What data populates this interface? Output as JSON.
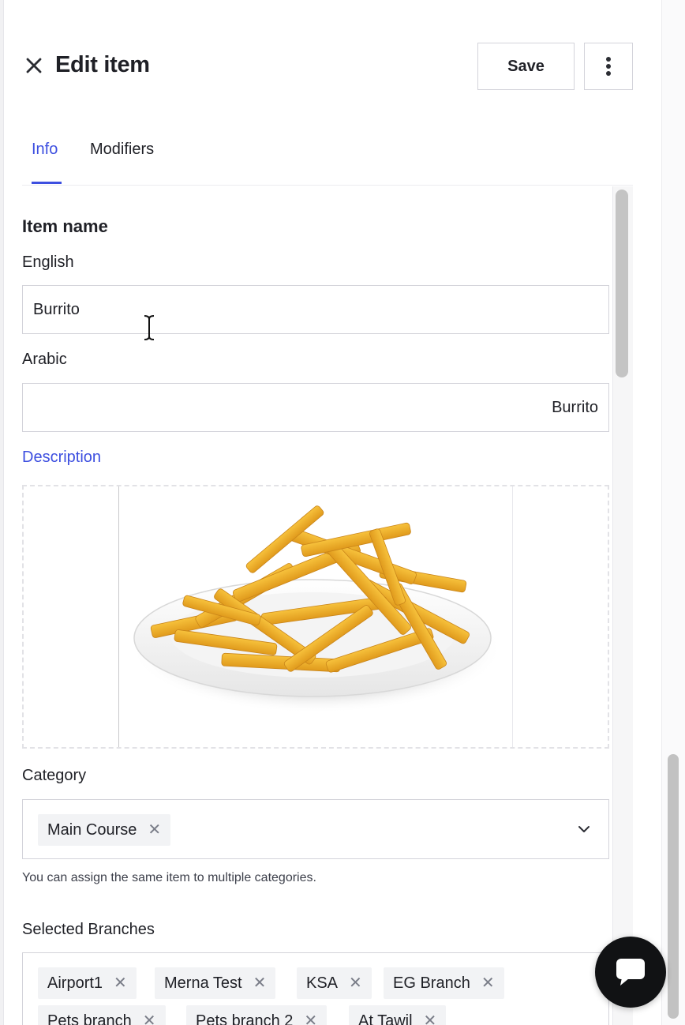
{
  "header": {
    "title": "Edit item",
    "save_label": "Save"
  },
  "tabs": [
    {
      "label": "Info",
      "active": true
    },
    {
      "label": "Modifiers",
      "active": false
    }
  ],
  "form": {
    "item_name_heading": "Item name",
    "english": {
      "label": "English",
      "value": "Burrito"
    },
    "arabic": {
      "label": "Arabic",
      "value": "Burrito"
    },
    "description_label": "Description",
    "category": {
      "label": "Category",
      "chips": [
        "Main Course"
      ],
      "helper": "You can assign the same item to multiple categories."
    },
    "branches": {
      "label": "Selected Branches",
      "chips": [
        "Airport1",
        "Merna Test",
        "KSA",
        "EG Branch",
        "Pets branch",
        "Pets branch 2",
        "At Tawil"
      ]
    }
  },
  "colors": {
    "accent": "#3d4fe0",
    "text": "#1f2026",
    "border": "#d3d3da",
    "chip_bg": "#f2f3f5",
    "chat_button": "#111214"
  },
  "icons": {
    "close": "close-icon",
    "more": "more-vertical-icon",
    "chevron": "chevron-down-icon",
    "chip_remove": "x-icon",
    "chat": "chat-icon",
    "text_cursor": "text-cursor-icon"
  }
}
